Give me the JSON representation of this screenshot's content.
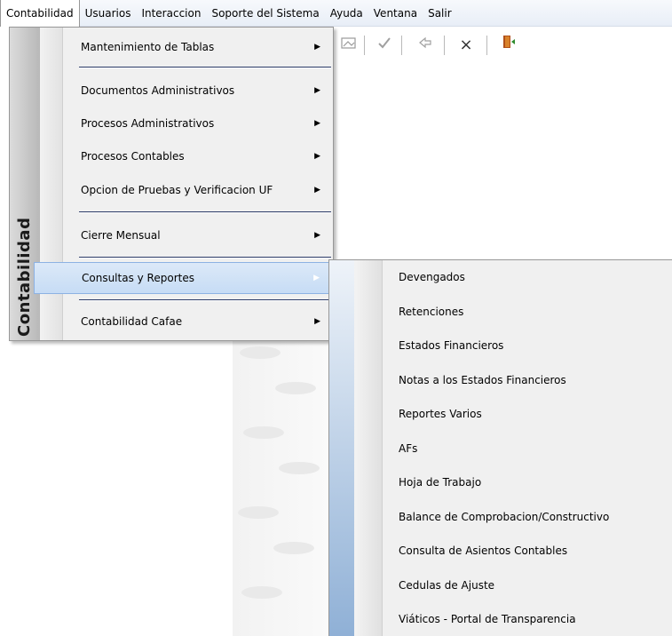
{
  "menubar": {
    "items": [
      "Contabilidad",
      "Usuarios",
      "Interaccion",
      "Soporte del Sistema",
      "Ayuda",
      "Ventana",
      "Salir"
    ]
  },
  "toolbar": {
    "icons": [
      "image-icon",
      "check-icon",
      "forward-icon",
      "close-icon",
      "exit-door-icon"
    ],
    "close_glyph": "×"
  },
  "menu": {
    "banner": "Contabilidad",
    "items": [
      {
        "label": "Mantenimiento de Tablas",
        "submenu": true
      },
      {
        "label": "Documentos Administrativos",
        "submenu": true
      },
      {
        "label": "Procesos Administrativos",
        "submenu": true
      },
      {
        "label": "Procesos Contables",
        "submenu": true
      },
      {
        "label": "Opcion de Pruebas y Verificacion UF",
        "submenu": true
      },
      {
        "label": "Cierre Mensual",
        "submenu": true
      },
      {
        "label": "Consultas y Reportes",
        "submenu": true,
        "highlighted": true
      },
      {
        "label": "Contabilidad Cafae",
        "submenu": true
      }
    ],
    "arrow": "▶"
  },
  "submenu": {
    "items": [
      "Devengados",
      "Retenciones",
      "Estados Financieros",
      "Notas a los Estados Financieros",
      "Reportes Varios",
      "AFs",
      "Hoja de Trabajo",
      "Balance de Comprobacion/Constructivo",
      "Consulta de Asientos Contables",
      "Cedulas de Ajuste",
      "Viáticos - Portal de Transparencia"
    ]
  },
  "colors": {
    "highlight": "#c6dcf5",
    "separator": "#2b3a67",
    "menu_bg": "#f0f0f0"
  }
}
